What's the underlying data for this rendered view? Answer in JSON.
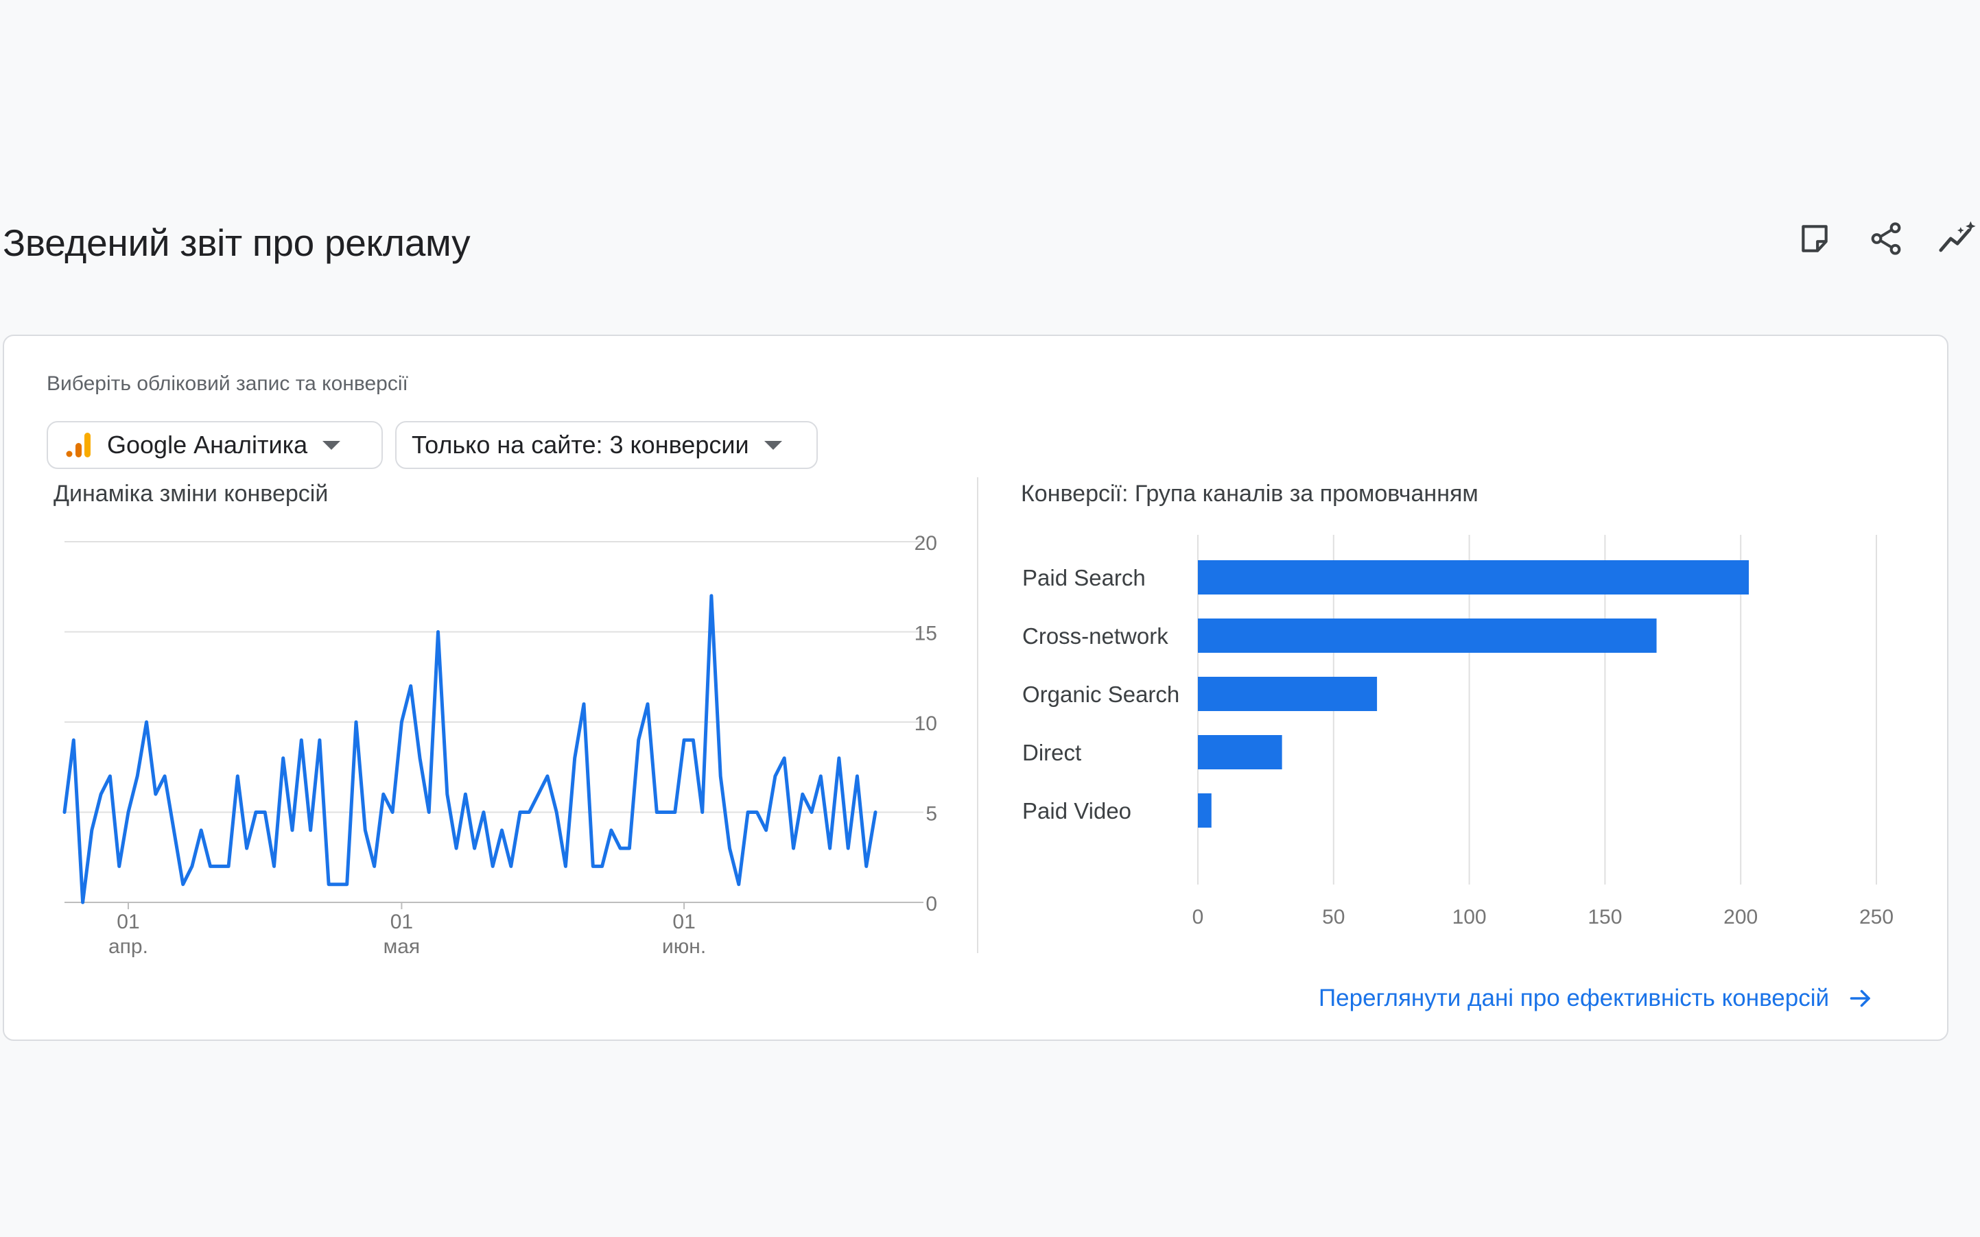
{
  "page": {
    "title": "Зведений звіт про рекламу"
  },
  "header_actions": [
    {
      "icon": "notes-icon"
    },
    {
      "icon": "share-icon"
    },
    {
      "icon": "insights-icon"
    }
  ],
  "card": {
    "select_label": "Виберіть обліковий запис та конверсії",
    "account_dropdown": {
      "value": "Google Аналітика",
      "icon": "google-analytics-logo"
    },
    "conversion_dropdown": {
      "value": "Только на сайте: 3 конверсии"
    },
    "footer_link": {
      "label": "Переглянути дані про ефективність конверсій",
      "icon": "arrow-right-icon"
    }
  },
  "colors": {
    "accent": "#1a73e8",
    "bar": "#1a73e8",
    "grid": "#e0e0e0",
    "ga_orange": "#f9ab00",
    "ga_dark_orange": "#e37400"
  },
  "chart_data": [
    {
      "type": "line",
      "title": "Динаміка зміни конверсій",
      "y_axis_side": "right",
      "ylim": [
        0,
        20
      ],
      "yticks": [
        "0",
        "5",
        "10",
        "15",
        "20"
      ],
      "x_ticks": [
        {
          "index": 7,
          "day": "01",
          "month": "апр."
        },
        {
          "index": 37,
          "day": "01",
          "month": "мая"
        },
        {
          "index": 68,
          "day": "01",
          "month": "июн."
        }
      ],
      "grid": true,
      "series": [
        {
          "values": [
            5,
            9,
            0,
            4,
            6,
            7,
            2,
            5,
            7,
            10,
            6,
            7,
            4,
            1,
            2,
            4,
            2,
            2,
            2,
            7,
            3,
            5,
            5,
            2,
            8,
            4,
            9,
            4,
            9,
            1,
            1,
            1,
            10,
            4,
            2,
            6,
            5,
            10,
            12,
            8,
            5,
            15,
            6,
            3,
            6,
            3,
            5,
            2,
            4,
            2,
            5,
            5,
            6,
            7,
            5,
            2,
            8,
            11,
            2,
            2,
            4,
            3,
            3,
            9,
            11,
            5,
            5,
            5,
            9,
            9,
            5,
            17,
            7,
            3,
            1,
            5,
            5,
            4,
            7,
            8,
            3,
            6,
            5,
            7,
            3,
            8,
            3,
            7,
            2,
            5
          ]
        }
      ]
    },
    {
      "type": "bar",
      "orientation": "horizontal",
      "title": "Конверсії: Група каналів за промовчанням",
      "categories": [
        "Paid Search",
        "Cross-network",
        "Organic Search",
        "Direct",
        "Paid Video"
      ],
      "values": [
        203,
        169,
        66,
        31,
        5
      ],
      "xlim": [
        0,
        250
      ],
      "xticks": [
        "0",
        "50",
        "100",
        "150",
        "200",
        "250"
      ],
      "grid": true
    }
  ]
}
